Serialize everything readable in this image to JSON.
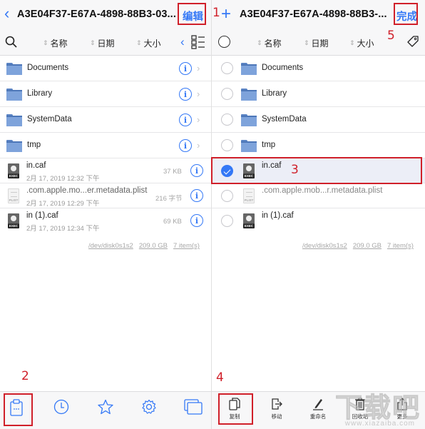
{
  "left": {
    "title": "A3E04F37-E67A-4898-88B3-03...",
    "edit_label": "编辑",
    "sort": [
      "名称",
      "日期",
      "大小"
    ],
    "folders": [
      {
        "name": "Documents"
      },
      {
        "name": "Library"
      },
      {
        "name": "SystemData"
      },
      {
        "name": "tmp"
      }
    ],
    "files": [
      {
        "name": "in.caf",
        "date": "2月 17, 2019 12:32 下午",
        "size": "37 KB",
        "type": "exec"
      },
      {
        "name": ".com.apple.mo...er.metadata.plist",
        "date": "2月 17, 2019 12:29 下午",
        "size": "216 字节",
        "type": "plist"
      },
      {
        "name": "in (1).caf",
        "date": "2月 17, 2019 12:34 下午",
        "size": "69 KB",
        "type": "exec"
      }
    ],
    "footer": {
      "device": "/dev/disk0s1s2",
      "capacity": "209.0 GB",
      "items": "7 item(s)"
    }
  },
  "right": {
    "title": "A3E04F37-E67A-4898-88B3-...",
    "done_label": "完成",
    "sort": [
      "名称",
      "日期",
      "大小"
    ],
    "folders": [
      {
        "name": "Documents",
        "selected": false
      },
      {
        "name": "Library",
        "selected": false
      },
      {
        "name": "SystemData",
        "selected": false
      },
      {
        "name": "tmp",
        "selected": false
      }
    ],
    "files": [
      {
        "name": "in.caf",
        "selected": true,
        "type": "exec"
      },
      {
        "name": ".com.apple.mob...r.metadata.plist",
        "selected": false,
        "type": "plist"
      },
      {
        "name": "in (1).caf",
        "selected": false,
        "type": "exec"
      }
    ],
    "footer": {
      "device": "/dev/disk0s1s2",
      "capacity": "209.0 GB",
      "items": "7 item(s)"
    },
    "actions": [
      {
        "label": "复制",
        "icon": "copy-icon"
      },
      {
        "label": "移动",
        "icon": "move-icon"
      },
      {
        "label": "重命名",
        "icon": "rename-icon"
      },
      {
        "label": "回收站",
        "icon": "trash-icon"
      },
      {
        "label": "更多",
        "icon": "share-icon"
      }
    ]
  },
  "left_tabbar": [
    "clipboard-icon",
    "clock-icon",
    "star-icon",
    "gear-icon",
    "windows-icon"
  ],
  "annotations": [
    "1",
    "2",
    "3",
    "4",
    "5"
  ],
  "watermark": {
    "text": "下载吧",
    "sub": "www.xiazaiba.com"
  },
  "colors": {
    "accent": "#3478f6",
    "annotation": "#d0202a",
    "folder": "#7ea3db"
  }
}
